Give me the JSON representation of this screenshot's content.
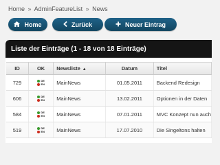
{
  "breadcrumb": [
    "Home",
    "AdminFeatureList",
    "News"
  ],
  "breadcrumb_sep": "»",
  "buttons": {
    "home": {
      "label": "Home",
      "icon": "home-icon"
    },
    "back": {
      "label": "Zurück",
      "icon": "chevron-left-icon"
    },
    "new_entry": {
      "label": "Neuer Eintrag",
      "icon": "plus-icon"
    }
  },
  "panel": {
    "title": "Liste der Einträge (1 - 18 von 18 Einträge)"
  },
  "table": {
    "columns": {
      "id": "ID",
      "ok": "OK",
      "newsliste": "Newsliste",
      "datum": "Datum",
      "titel": "Titel"
    },
    "sort_indicator": "▲",
    "rows": [
      {
        "id": "729",
        "newsliste": "MainNews",
        "datum": "01.05.2011",
        "titel": "Backend Redesign"
      },
      {
        "id": "606",
        "newsliste": "MainNews",
        "datum": "13.02.2011",
        "titel": "Optionen in der Daten"
      },
      {
        "id": "584",
        "newsliste": "MainNews",
        "datum": "07.01.2011",
        "titel": "MVC Konzept nun auch"
      },
      {
        "id": "519",
        "newsliste": "MainNews",
        "datum": "17.07.2010",
        "titel": "Die Singeltons halten"
      }
    ],
    "ok_flags": [
      {
        "code": "DE",
        "color": "#3a9a2e"
      },
      {
        "code": "EN",
        "color": "#cc2b1d"
      }
    ]
  },
  "colors": {
    "button": "#16506f",
    "panel_header": "#151515",
    "ok_green": "#3a9a2e",
    "ok_red": "#cc2b1d"
  }
}
